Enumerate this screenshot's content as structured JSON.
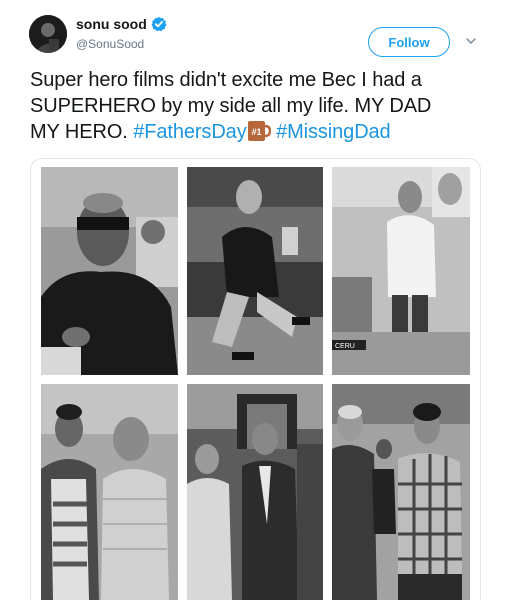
{
  "user": {
    "display_name": "sonu sood",
    "handle": "@SonuSood",
    "verified_icon": "verified-badge-icon"
  },
  "follow": {
    "label": "Follow"
  },
  "tweet": {
    "line1": "Super hero films didn't excite me Bec I had a",
    "line2": "SUPERHERO by my side all my life. MY DAD",
    "line3_plain": "MY HERO. ",
    "hashtag1": "#FathersDay",
    "emoji": "#1",
    "hashtag2": "#MissingDad"
  },
  "media": {
    "photos": [
      {
        "name": "photo-father-sunglasses"
      },
      {
        "name": "photo-father-on-sofa"
      },
      {
        "name": "photo-father-standing-mall"
      },
      {
        "name": "photo-sonu-with-father"
      },
      {
        "name": "photo-father-and-son-hotel"
      },
      {
        "name": "photo-father-with-young-sonu"
      }
    ],
    "sign_text": "CERU"
  },
  "colors": {
    "accent": "#1da1f2",
    "hashtag": "#1b95e0",
    "muted": "#657786"
  }
}
